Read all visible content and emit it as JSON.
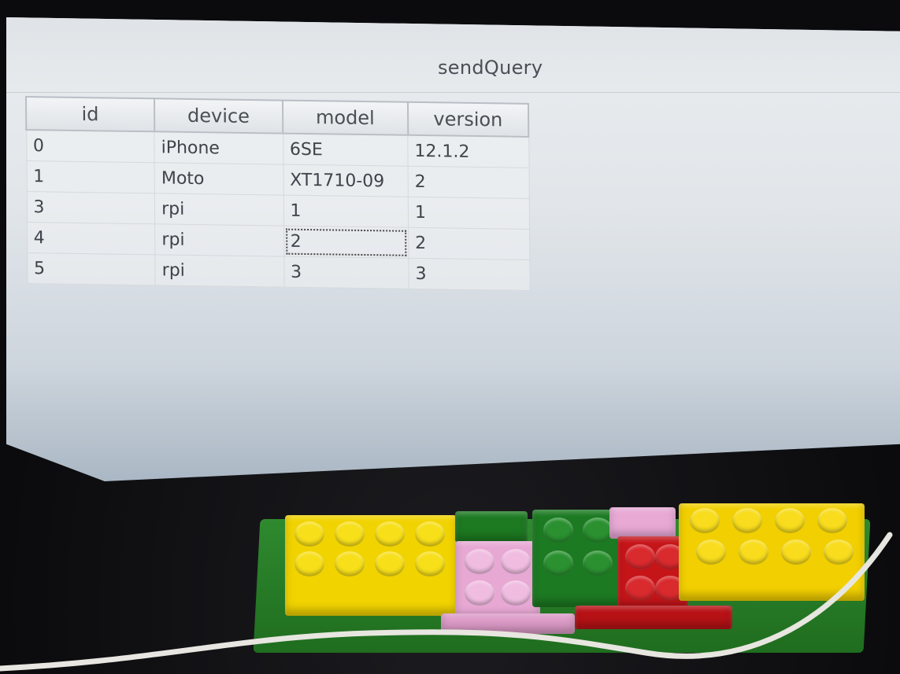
{
  "window": {
    "title": "sendQuery"
  },
  "table": {
    "columns": [
      "id",
      "device",
      "model",
      "version"
    ],
    "rows": [
      [
        "0",
        "iPhone",
        "6SE",
        "12.1.2"
      ],
      [
        "1",
        "Moto",
        "XT1710-09",
        "2"
      ],
      [
        "3",
        "rpi",
        "1",
        "1"
      ],
      [
        "4",
        "rpi",
        "2",
        "2"
      ],
      [
        "5",
        "rpi",
        "3",
        "3"
      ]
    ],
    "selected_cell": {
      "row": 3,
      "column": "model"
    }
  },
  "colors": {
    "screen_background": "#e4e8ec",
    "header_background": "#e6e9ec",
    "text": "#3f434a",
    "lego_yellow": "#f2d400",
    "lego_pink": "#e9a9d6",
    "lego_green": "#1f7a1f",
    "lego_red": "#c8161b"
  }
}
